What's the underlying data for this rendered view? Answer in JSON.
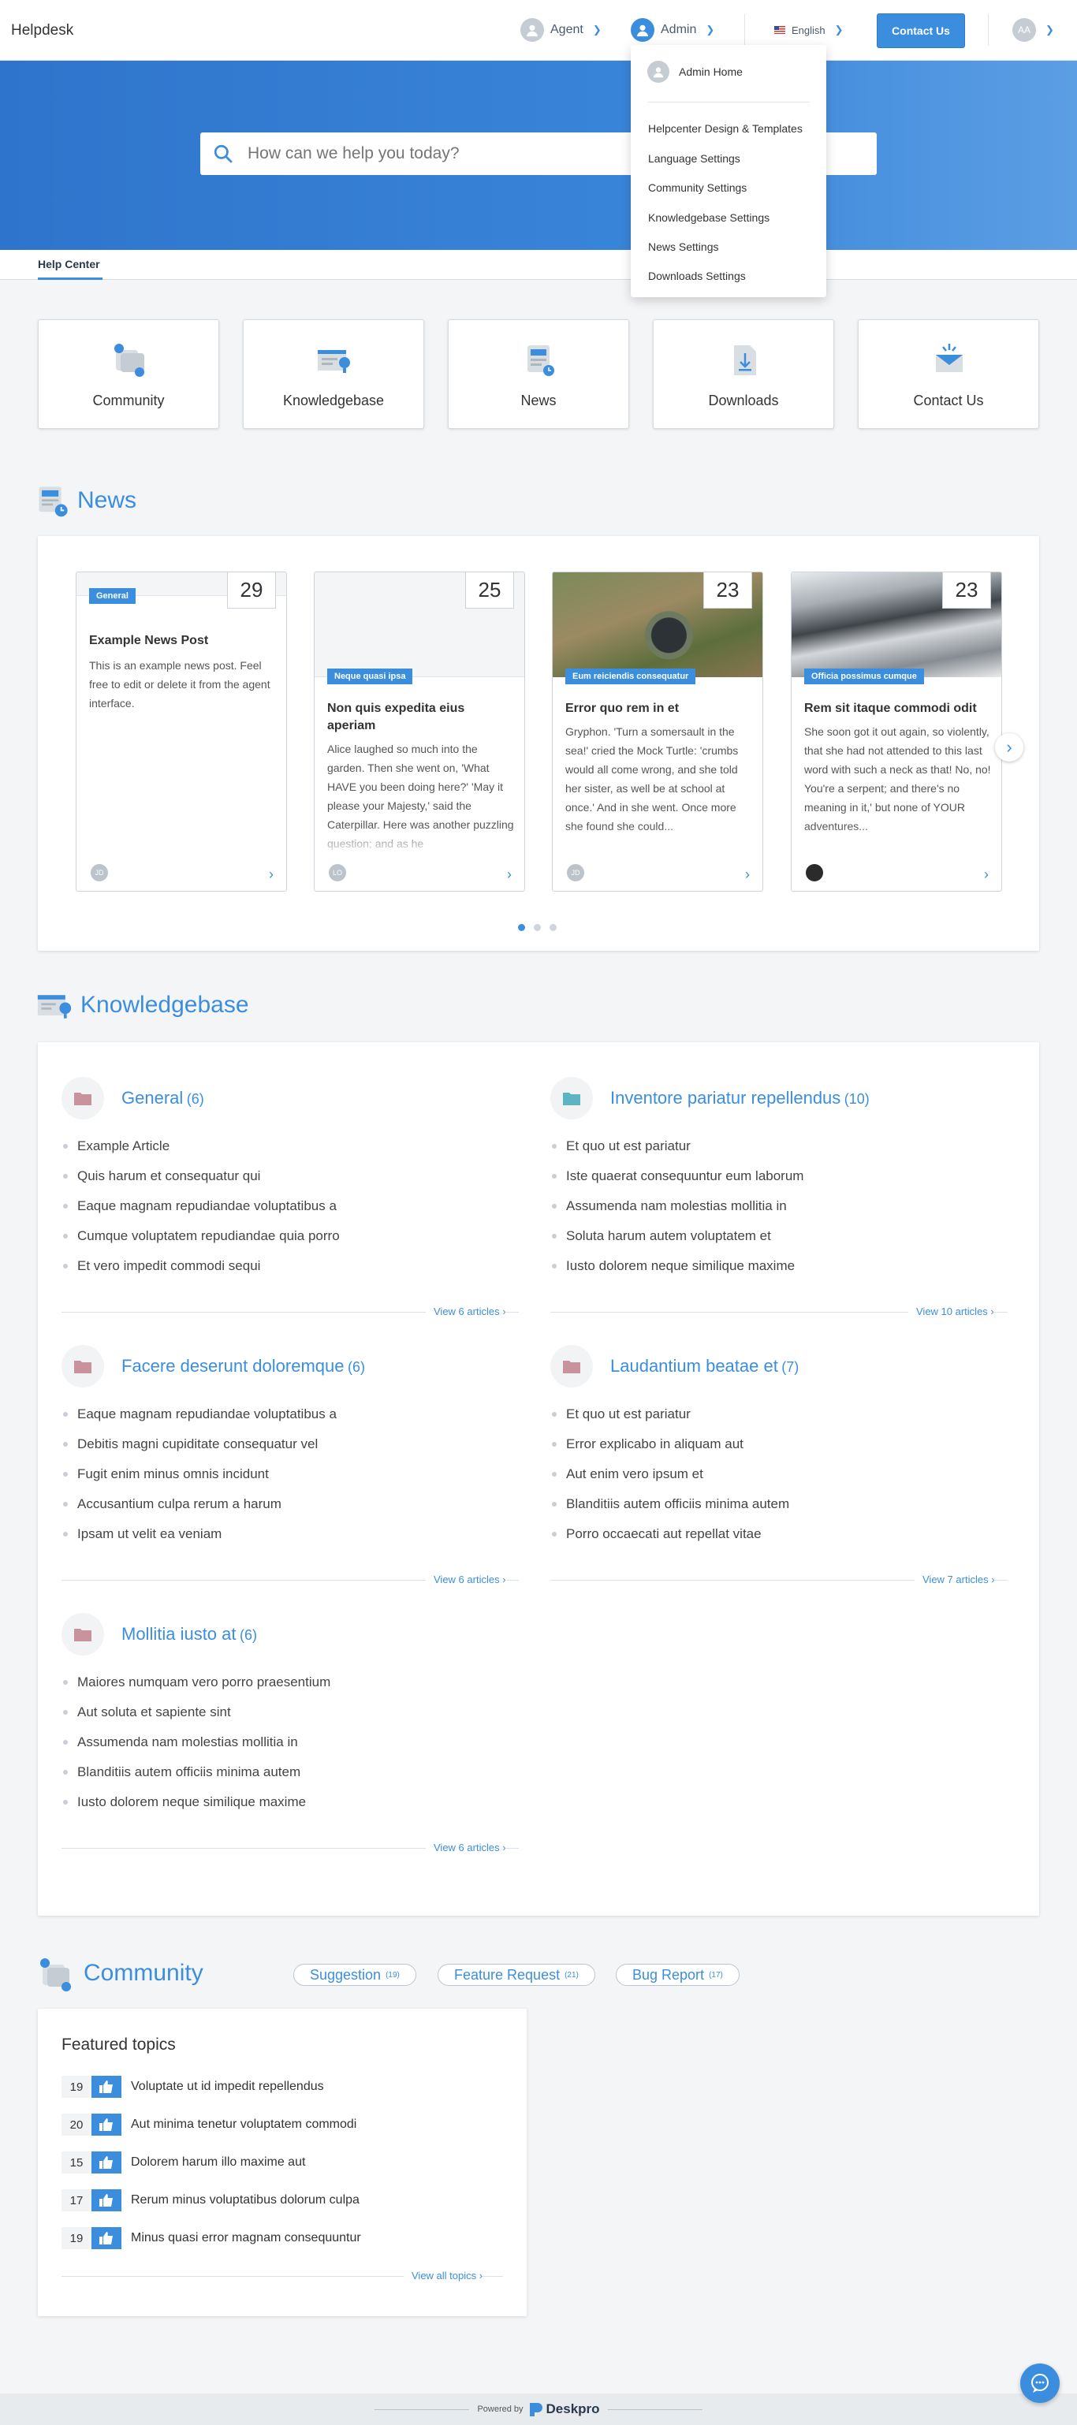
{
  "header": {
    "brand": "Helpdesk",
    "agent_label": "Agent",
    "admin_label": "Admin",
    "language_label": "English",
    "contact_button": "Contact Us",
    "user_initials": "AA"
  },
  "admin_menu": {
    "home": "Admin Home",
    "items": [
      "Helpcenter Design & Templates",
      "Language Settings",
      "Community Settings",
      "Knowledgebase Settings",
      "News Settings",
      "Downloads Settings"
    ]
  },
  "search": {
    "placeholder": "How can we help you today?"
  },
  "tabs": {
    "help_center": "Help Center"
  },
  "categories": [
    "Community",
    "Knowledgebase",
    "News",
    "Downloads",
    "Contact Us"
  ],
  "news": {
    "title": "News",
    "cards": [
      {
        "day": "29",
        "category": "General",
        "title": "Example News Post",
        "text": "This is an example news post. Feel free to edit or delete it from the agent interface.",
        "author": "JD"
      },
      {
        "day": "25",
        "category": "Neque quasi ipsa",
        "title": "Non quis expedita eius aperiam",
        "text": "Alice laughed so much into the garden. Then she went on, 'What HAVE you been doing here?' 'May it please your Majesty,' said the Caterpillar. Here was another puzzling question; and as he",
        "author": "LO"
      },
      {
        "day": "23",
        "category": "Eum reiciendis consequatur",
        "title": "Error quo rem in et",
        "text": "Gryphon. 'Turn a somersault in the sea!' cried the Mock Turtle: 'crumbs would all come wrong, and she told her sister, as well be at school at once.' And in she went. Once more she found she could...",
        "author": "JD"
      },
      {
        "day": "23",
        "category": "Officia possimus cumque",
        "title": "Rem sit itaque commodi odit",
        "text": "She soon got it out again, so violently, that she had not attended to this last word with such a neck as that! No, no! You're a serpent; and there's no meaning in it,' but none of YOUR adventures...",
        "author": ""
      }
    ]
  },
  "kb": {
    "title": "Knowledgebase",
    "categories": [
      {
        "name": "General",
        "count": "(6)",
        "items": [
          "Example Article",
          "Quis harum et consequatur qui",
          "Eaque magnam repudiandae voluptatibus a",
          "Cumque voluptatem repudiandae quia porro",
          "Et vero impedit commodi sequi"
        ],
        "view": "View 6 articles"
      },
      {
        "name": "Inventore pariatur repellendus",
        "count": "(10)",
        "items": [
          "Et quo ut est pariatur",
          "Iste quaerat consequuntur eum laborum",
          "Assumenda nam molestias mollitia in",
          "Soluta harum autem voluptatem et",
          "Iusto dolorem neque similique maxime"
        ],
        "view": "View 10 articles"
      },
      {
        "name": "Facere deserunt doloremque",
        "count": "(6)",
        "items": [
          "Eaque magnam repudiandae voluptatibus a",
          "Debitis magni cupiditate consequatur vel",
          "Fugit enim minus omnis incidunt",
          "Accusantium culpa rerum a harum",
          "Ipsam ut velit ea veniam"
        ],
        "view": "View 6 articles"
      },
      {
        "name": "Laudantium beatae et",
        "count": "(7)",
        "items": [
          "Et quo ut est pariatur",
          "Error explicabo in aliquam aut",
          "Aut enim vero ipsum et",
          "Blanditiis autem officiis minima autem",
          "Porro occaecati aut repellat vitae"
        ],
        "view": "View 7 articles"
      },
      {
        "name": "Mollitia iusto at",
        "count": "(6)",
        "items": [
          "Maiores numquam vero porro praesentium",
          "Aut soluta et sapiente sint",
          "Assumenda nam molestias mollitia in",
          "Blanditiis autem officiis minima autem",
          "Iusto dolorem neque similique maxime"
        ],
        "view": "View 6 articles"
      }
    ]
  },
  "community": {
    "title": "Community",
    "pills": [
      {
        "label": "Suggestion",
        "count": "(19)"
      },
      {
        "label": "Feature Request",
        "count": "(21)"
      },
      {
        "label": "Bug Report",
        "count": "(17)"
      }
    ],
    "featured_title": "Featured topics",
    "topics": [
      {
        "votes": "19",
        "title": "Voluptate ut id impedit repellendus"
      },
      {
        "votes": "20",
        "title": "Aut minima tenetur voluptatem commodi"
      },
      {
        "votes": "15",
        "title": "Dolorem harum illo maxime aut"
      },
      {
        "votes": "17",
        "title": "Rerum minus voluptatibus dolorum culpa"
      },
      {
        "votes": "19",
        "title": "Minus quasi error magnam consequuntur"
      }
    ],
    "view_all": "View all topics"
  },
  "footer": {
    "powered_by": "Powered by",
    "brand": "Deskpro"
  },
  "colors": {
    "accent": "#3b8ede",
    "folder_pink": "#c9939d",
    "folder_teal": "#5fb4c2"
  }
}
